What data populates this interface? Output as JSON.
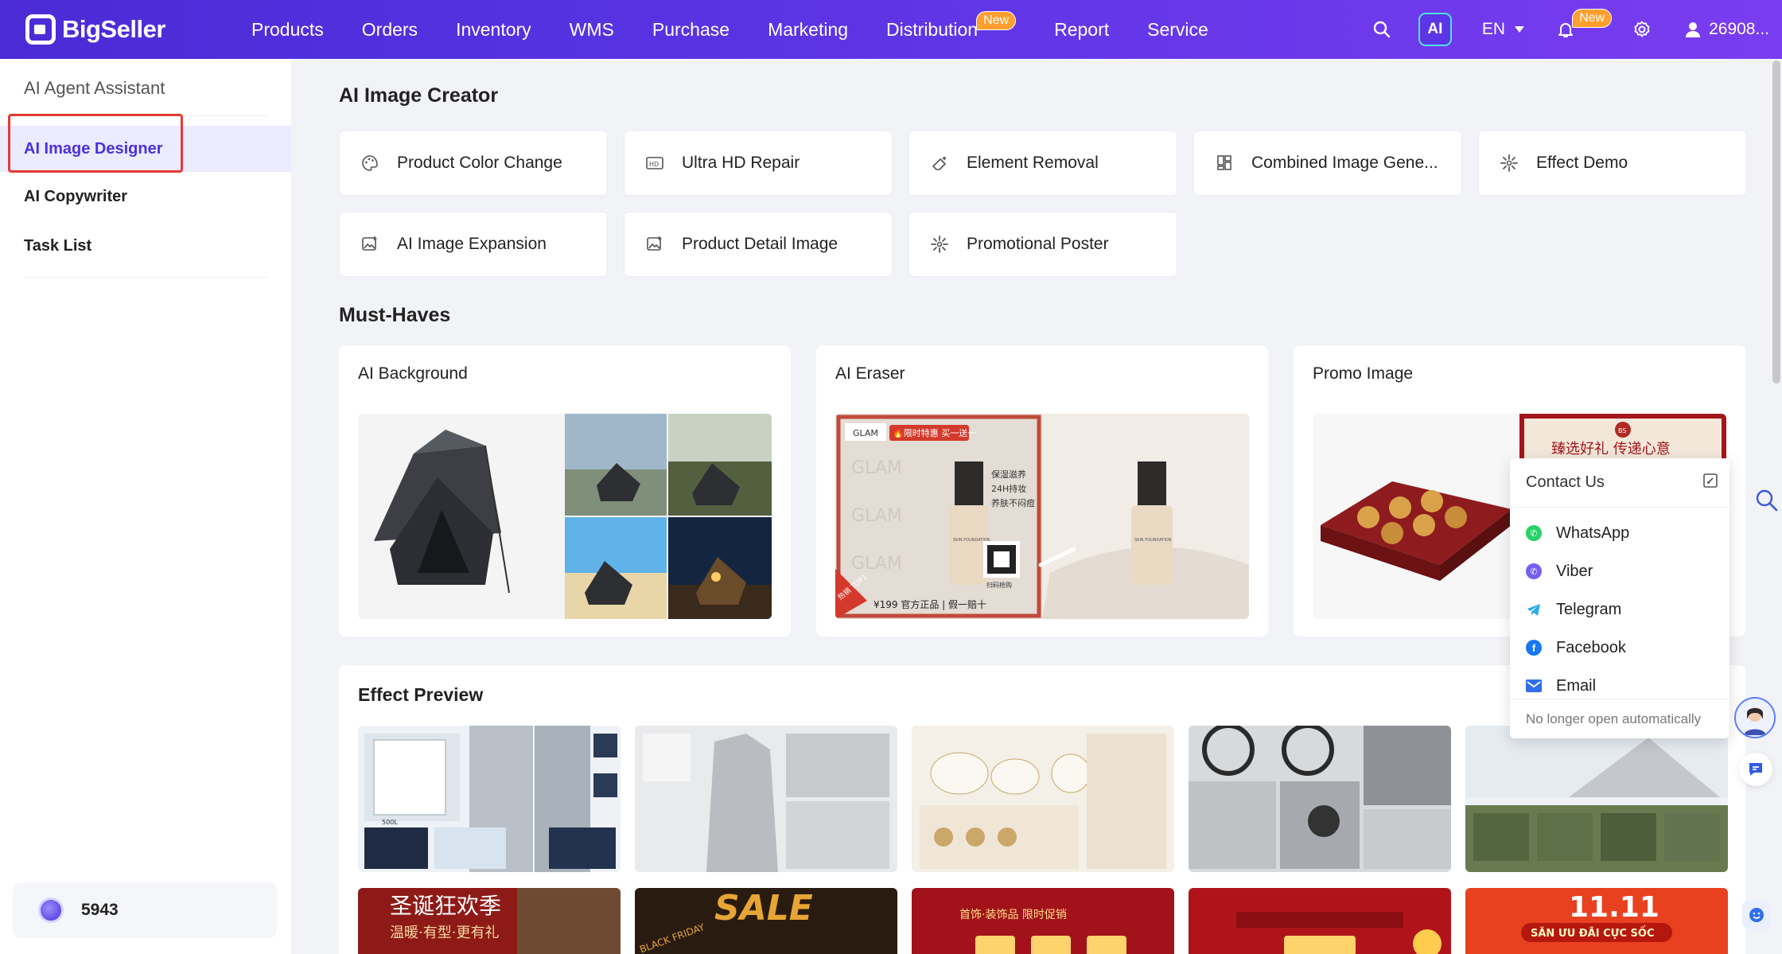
{
  "brand": {
    "name": "BigSeller"
  },
  "nav": {
    "items": [
      "Products",
      "Orders",
      "Inventory",
      "WMS",
      "Purchase",
      "Marketing",
      "Distribution",
      "Report",
      "Service"
    ],
    "distribution_badge": "New",
    "ai_label": "AI",
    "language": "EN",
    "bell_badge": "New",
    "user": "26908..."
  },
  "sidebar": {
    "title": "AI Agent Assistant",
    "items": [
      "AI Image Designer",
      "AI Copywriter",
      "Task List"
    ],
    "active_index": 0,
    "credits": "5943"
  },
  "creator": {
    "title": "AI Image Creator",
    "tools": [
      {
        "label": "Product Color Change",
        "icon": "palette-icon"
      },
      {
        "label": "Ultra HD Repair",
        "icon": "hd-icon"
      },
      {
        "label": "Element Removal",
        "icon": "eraser-icon"
      },
      {
        "label": "Combined Image Gene...",
        "icon": "grid-icon"
      },
      {
        "label": "Effect Demo",
        "icon": "sparkle-icon"
      },
      {
        "label": "AI Image Expansion",
        "icon": "image-expand-icon"
      },
      {
        "label": "Product Detail Image",
        "icon": "image-detail-icon"
      },
      {
        "label": "Promotional Poster",
        "icon": "sparkle-icon"
      }
    ]
  },
  "must_haves": {
    "title": "Must-Haves",
    "cards": [
      {
        "title": "AI Background"
      },
      {
        "title": "AI Eraser"
      },
      {
        "title": "Promo Image"
      }
    ],
    "eraser_image": {
      "brand": "GLAM",
      "tag": "🔥限时特惠 买一送一",
      "feature1": "保湿滋养",
      "feature2": "24H持妆",
      "feature3": "养肤不闷痘",
      "bottle": "SKIN FOUNDATION",
      "price": "¥199 官方正品 | 假一赔十",
      "hot": "热销 TOP1",
      "qr_caption": "扫码抢购"
    },
    "promo_image": {
      "banner": "臻选好礼 传递心意",
      "seal": "BS"
    }
  },
  "effect_preview": {
    "title": "Effect Preview",
    "fridge_capacity": "500L",
    "poster_texts": [
      "圣诞狂欢季",
      "温暖·有型·更有礼",
      "SALE",
      "BLACK FRIDAY",
      "首饰·装饰品 限时促销",
      "11.11",
      "SĂN ƯU ĐÃI CỰC SỐC"
    ]
  },
  "contact": {
    "title": "Contact Us",
    "items": [
      {
        "label": "WhatsApp",
        "color": "#25D366"
      },
      {
        "label": "Viber",
        "color": "#7360F2"
      },
      {
        "label": "Telegram",
        "color": "#2AABEE"
      },
      {
        "label": "Facebook",
        "color": "#1877F2"
      },
      {
        "label": "Email",
        "color": "#2F6FEB"
      }
    ],
    "footer": "No longer open automatically"
  },
  "colors": {
    "accent": "#4b31d8",
    "highlight_border": "#e53935"
  }
}
